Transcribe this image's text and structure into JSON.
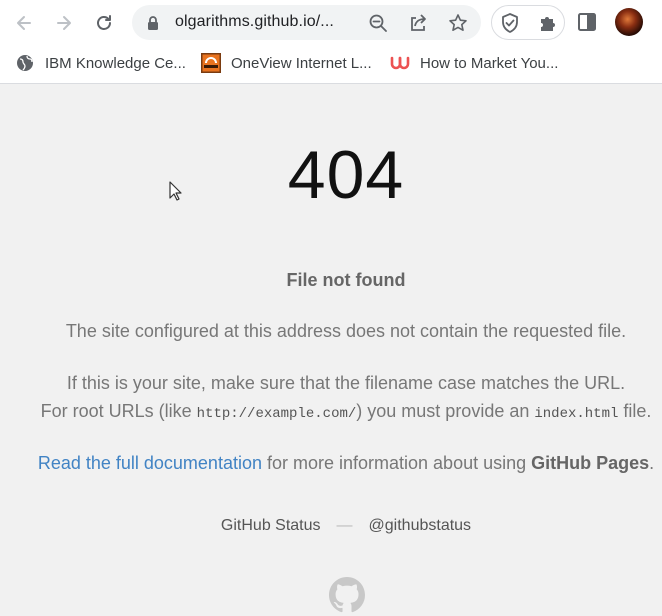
{
  "browser": {
    "url": "olgarithms.github.io/...",
    "bookmarks": [
      {
        "label": "IBM Knowledge Ce...",
        "icon": "globe-icon"
      },
      {
        "label": "OneView Internet L...",
        "icon": "oneview-favicon-icon"
      },
      {
        "label": "How to Market You...",
        "icon": "udemy-favicon-icon"
      }
    ],
    "colors": {
      "toolbar": "#ffffff",
      "omnibox": "#f1f3f4",
      "icon": "#5f6368"
    }
  },
  "page": {
    "code": "404",
    "title": "File not found",
    "message_1": "The site configured at this address does not contain the requested file.",
    "message_2": "If this is your site, make sure that the filename case matches the URL.",
    "message_3_prefix": "For root URLs (like ",
    "message_3_code_1": "http://example.com/",
    "message_3_middle": ") you must provide an ",
    "message_3_code_2": "index.html",
    "message_3_suffix": " file.",
    "doc_link": "Read the full documentation",
    "doc_text": " for more information about using ",
    "doc_strong": "GitHub Pages",
    "doc_end": ".",
    "footer": {
      "status": "GitHub Status",
      "separator": "—",
      "handle": "@githubstatus"
    },
    "colors": {
      "background": "#f1f1f1",
      "link": "#4183c4",
      "text": "#777777"
    }
  }
}
